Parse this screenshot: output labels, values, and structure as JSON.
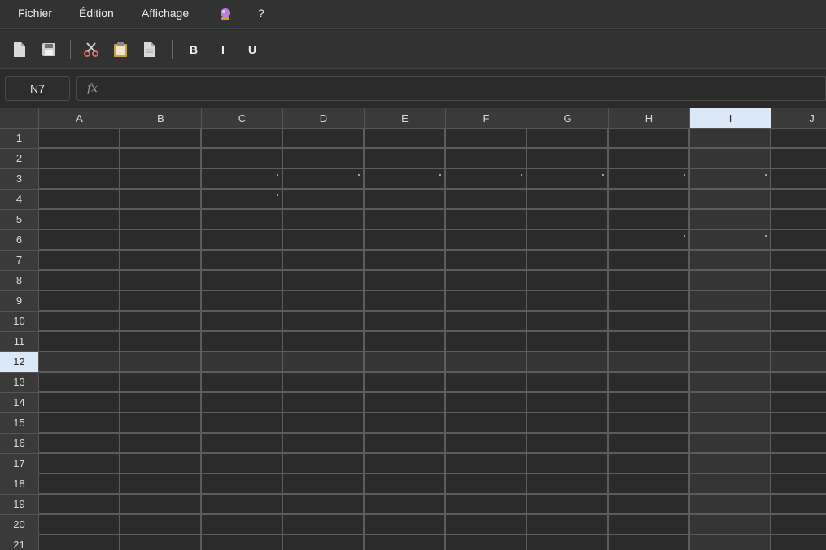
{
  "menu": {
    "file": "Fichier",
    "edit": "Édition",
    "view": "Affichage",
    "magic_icon": "crystal-ball-icon",
    "help": "?"
  },
  "toolbar": {
    "new_icon": "new-document-icon",
    "save_icon": "save-icon",
    "cut_icon": "scissors-icon",
    "paste_icon": "clipboard-icon",
    "copy_icon": "document-copy-icon",
    "bold": "B",
    "italic": "I",
    "underline": "U"
  },
  "formula": {
    "name_box": "N7",
    "fx_label": "fx",
    "value": ""
  },
  "sheet": {
    "columns": [
      "A",
      "B",
      "C",
      "D",
      "E",
      "F",
      "G",
      "H",
      "I",
      "J"
    ],
    "rows": [
      "1",
      "2",
      "3",
      "4",
      "5",
      "6",
      "7",
      "8",
      "9",
      "10",
      "11",
      "12",
      "13",
      "14",
      "15",
      "16",
      "17",
      "18",
      "19",
      "20",
      "21"
    ],
    "selected_column": "I",
    "selected_row": "12"
  }
}
